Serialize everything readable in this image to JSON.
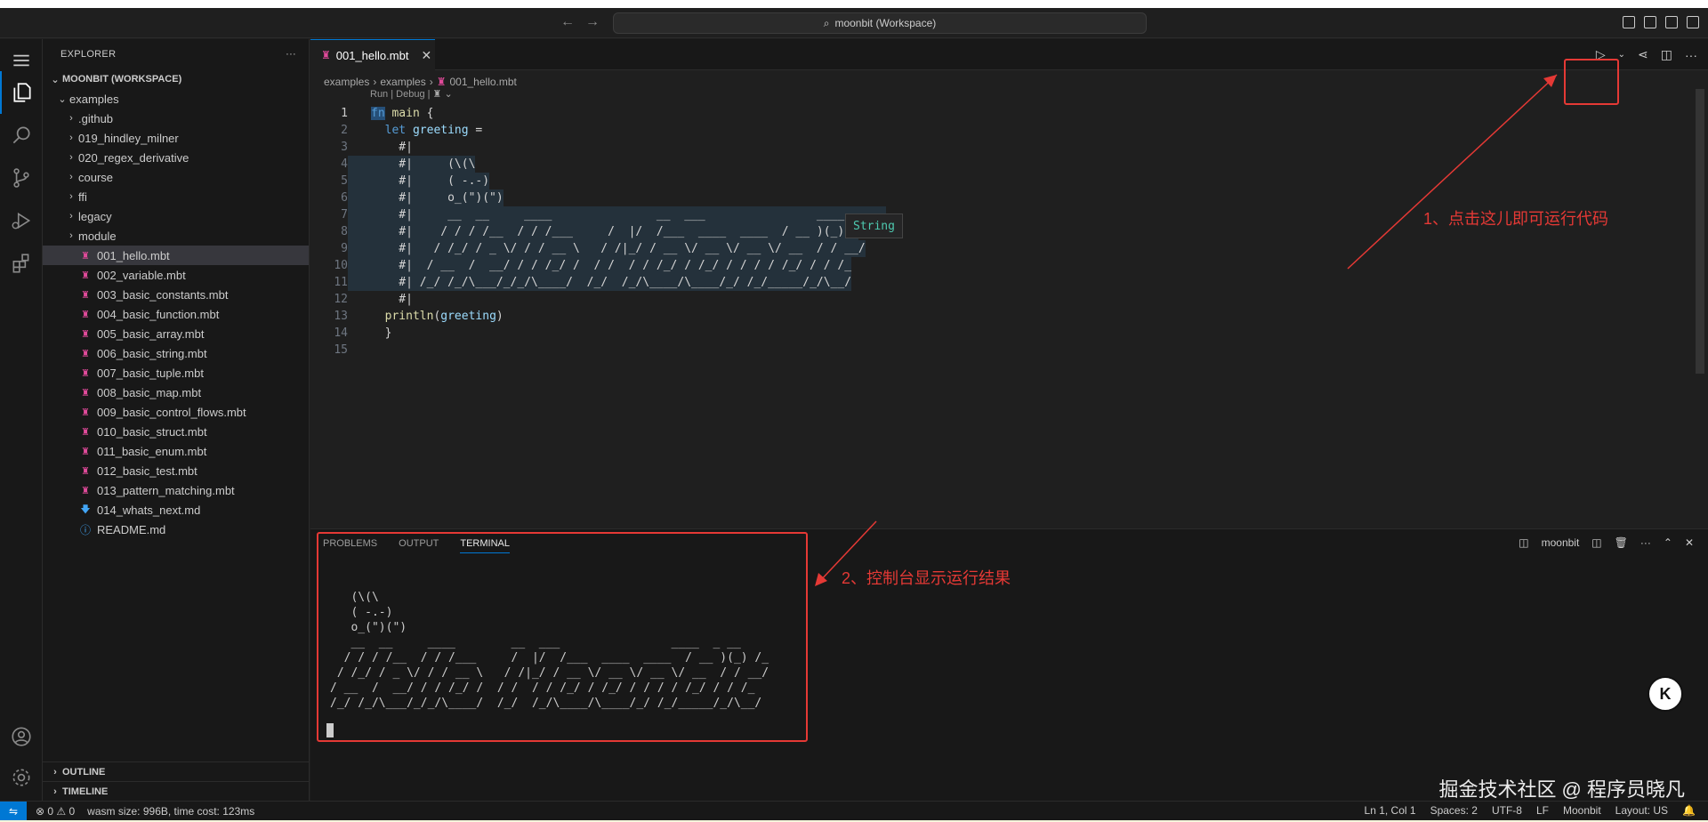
{
  "title_bar": {
    "search_text": "moonbit (Workspace)"
  },
  "sidebar": {
    "header": "EXPLORER",
    "workspace": "MOONBIT (WORKSPACE)",
    "folder": "examples",
    "subfolders": [
      ".github",
      "019_hindley_milner",
      "020_regex_derivative",
      "course",
      "ffi",
      "legacy",
      "module"
    ],
    "files": [
      "001_hello.mbt",
      "002_variable.mbt",
      "003_basic_constants.mbt",
      "004_basic_function.mbt",
      "005_basic_array.mbt",
      "006_basic_string.mbt",
      "007_basic_tuple.mbt",
      "008_basic_map.mbt",
      "009_basic_control_flows.mbt",
      "010_basic_struct.mbt",
      "011_basic_enum.mbt",
      "012_basic_test.mbt",
      "013_pattern_matching.mbt",
      "014_whats_next.md",
      "README.md"
    ],
    "outline": "OUTLINE",
    "timeline": "TIMELINE"
  },
  "editor": {
    "tab": "001_hello.mbt",
    "breadcrumb": [
      "examples",
      "examples",
      "001_hello.mbt"
    ],
    "codelens": "Run | Debug |",
    "line_numbers": [
      "1",
      "2",
      "3",
      "4",
      "5",
      "6",
      "7",
      "8",
      "9",
      "10",
      "11",
      "12",
      "13",
      "14",
      "15"
    ],
    "code": {
      "l1_kw": "fn",
      "l1_name": "main",
      "l1_rest": " {",
      "l2_kw": "let",
      "l2_var": "greeting",
      "l2_rest": " =",
      "l3": "    #|",
      "l4": "    #|     (\\(\\",
      "l5": "    #|     ( -.-)",
      "l6": "    #|     o_(\")(\")",
      "l7": "    #|     __  __     ____               __  ___                ____  _ __",
      "l8": "    #|    / / / /__  / / /___     /  |/  /___  ____  ____  / __ )(_) /",
      "l9": "    #|   / /_/ / _ \\/ / / __ \\   / /|_/ / __ \\/ __ \\/ __ \\/ __  / / __/",
      "l10": "    #|  / __  /  __/ / / /_/ /  / /  / / /_/ / /_/ / / / / /_/ / / /_",
      "l11": "    #| /_/ /_/\\___/_/_/\\____/  /_/  /_/\\____/\\____/_/ /_/_____/_/\\__/",
      "l12": "    #|",
      "l13_fn": "println",
      "l13_var": "greeting",
      "l14": "  }",
      "l15": ""
    },
    "hover_type": "String"
  },
  "panel": {
    "tabs": [
      "PROBLEMS",
      "OUTPUT",
      "TERMINAL"
    ],
    "terminal_name": "moonbit",
    "terminal_lines": [
      "   (\\(\\",
      "   ( -.-)",
      "   o_(\")(\")",
      "   __  __     ____        __  ___                ____  _ __",
      "  / / / /__  / / /___     /  |/  /___  ____  ____  / __ )(_) /_",
      " / /_/ / _ \\/ / / __ \\   / /|_/ / __ \\/ __ \\/ __ \\/ __  / / __/",
      "/ __  /  __/ / / /_/ /  / /  / / /_/ / /_/ / / / / /_/ / / /_",
      "/_/ /_/\\___/_/_/\\____/  /_/  /_/\\____/\\____/_/ /_/_____/_/\\__/"
    ]
  },
  "annotations": {
    "note1": "1、点击这儿即可运行代码",
    "note2": "2、控制台显示运行结果",
    "color": "#e53935"
  },
  "badge": "K",
  "watermark": "掘金技术社区 @ 程序员晓凡",
  "status_bar": {
    "problems": "⊗ 0 ⚠ 0",
    "message": "wasm size: 996B, time cost: 123ms",
    "position": "Ln 1, Col 1",
    "spaces": "Spaces: 2",
    "encoding": "UTF-8",
    "eol": "LF",
    "language": "Moonbit",
    "layout": "Layout: US"
  },
  "colors": {
    "accent": "#0078d4",
    "selection": "#37373d",
    "keyword": "#569cd6",
    "function": "#dcdcaa",
    "variable": "#9cdcfe"
  }
}
